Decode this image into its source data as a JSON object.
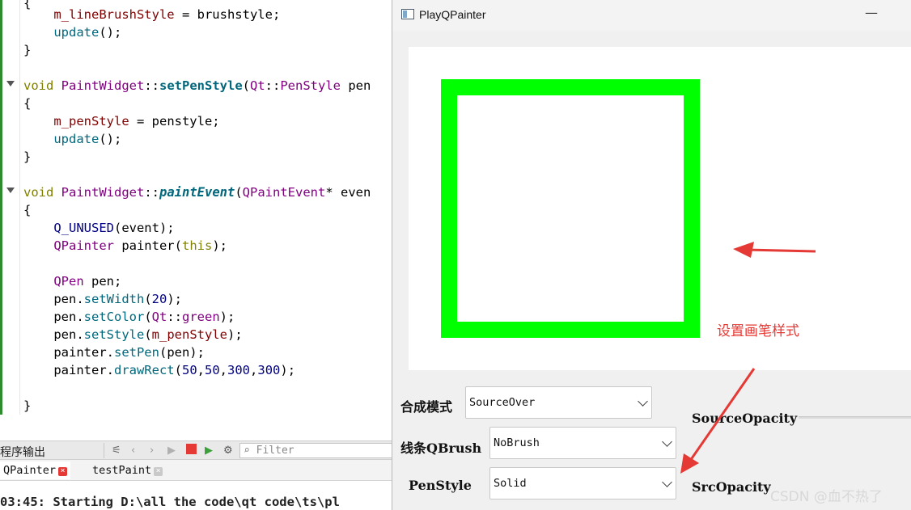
{
  "editor": {
    "lines": [
      {
        "text": "{"
      },
      {
        "text": "    m_lineBrushStyle = brushstyle;"
      },
      {
        "text": "    update();"
      },
      {
        "text": "}"
      },
      {
        "text": "void PaintWidget::setPenStyle(Qt::PenStyle pen"
      },
      {
        "text": "{"
      },
      {
        "text": "    m_penStyle = penstyle;"
      },
      {
        "text": "    update();"
      },
      {
        "text": "}"
      },
      {
        "text": "void PaintWidget::paintEvent(QPaintEvent* even"
      },
      {
        "text": "{"
      },
      {
        "text": "    Q_UNUSED(event);"
      },
      {
        "text": "    QPainter painter(this);"
      },
      {
        "text": "    QPen pen;"
      },
      {
        "text": "    pen.setWidth(20);"
      },
      {
        "text": "    pen.setColor(Qt::green);"
      },
      {
        "text": "    pen.setStyle(m_penStyle);"
      },
      {
        "text": "    painter.setPen(pen);"
      },
      {
        "text": "    painter.drawRect(50,50,300,300);"
      },
      {
        "text": "}"
      }
    ]
  },
  "output": {
    "pane_title": "程序输出",
    "filter_placeholder": "Filter",
    "tabs": [
      {
        "label": "QPainter",
        "active": true
      },
      {
        "label": "testPaint",
        "active": false
      }
    ],
    "log_line": "03:45: Starting D:\\all the code\\qt code\\ts\\pl"
  },
  "app_window": {
    "title": "PlayQPainter",
    "minimize_glyph": "—",
    "pen_color": "#00ff00",
    "controls": {
      "composition_label": "合成模式",
      "composition_value": "SourceOver",
      "line_brush_label": "线条QBrush",
      "line_brush_value": "NoBrush",
      "pen_style_label": "PenStyle",
      "pen_style_value": "Solid",
      "source_opacity_label": "SourceOpacity",
      "src_opacity_label": "SrcOpacity"
    }
  },
  "annotation": {
    "text": "设置画笔样式",
    "color": "#e53935"
  },
  "watermark": "CSDN @血不热了"
}
